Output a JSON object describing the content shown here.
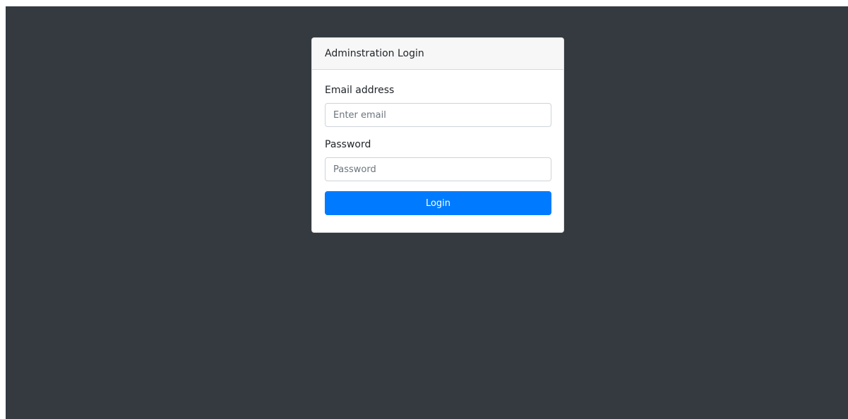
{
  "login_card": {
    "header_title": "Adminstration Login",
    "email": {
      "label": "Email address",
      "value": "",
      "placeholder": "Enter email"
    },
    "password": {
      "label": "Password",
      "value": "",
      "placeholder": "Password"
    },
    "submit_label": "Login"
  },
  "colors": {
    "background": "#343a40",
    "card": "#ffffff",
    "card_header": "#f7f7f7",
    "primary": "#007bff"
  }
}
